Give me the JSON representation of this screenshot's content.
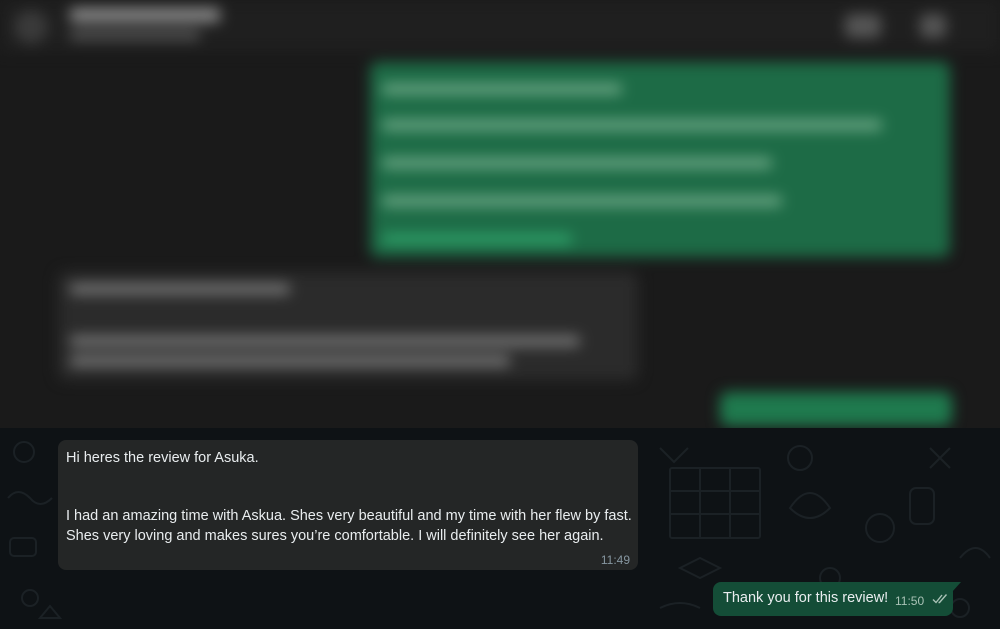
{
  "conversation": {
    "messages": [
      {
        "direction": "incoming",
        "lines": [
          "Hi heres the review for Asuka.",
          "I had an amazing time with Askua. Shes very beautiful and my time with her flew by fast.",
          "Shes very loving and makes sures you’re comfortable. I will definitely see her again."
        ],
        "time": "11:49"
      },
      {
        "direction": "outgoing",
        "text": "Thank you for this review!",
        "time": "11:50",
        "status_icon": "double-check-icon"
      }
    ]
  },
  "colors": {
    "incoming_bubble": "#242626",
    "outgoing_bubble": "#144d37",
    "chat_background": "#0e1215",
    "text": "#e9edef",
    "timestamp": "#8696a0"
  }
}
